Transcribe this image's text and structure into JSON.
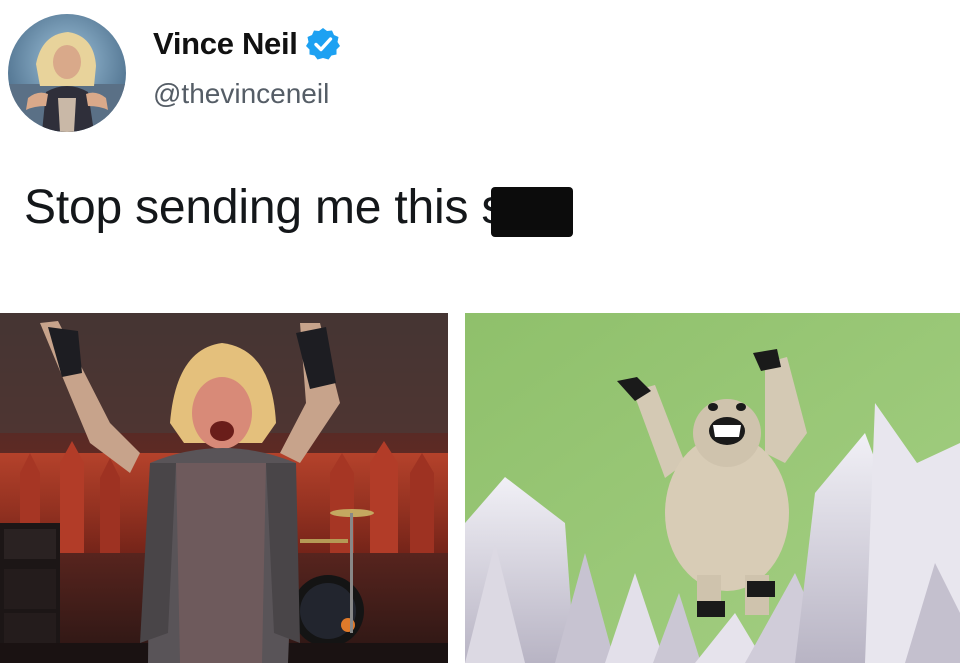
{
  "tweet": {
    "display_name": "Vince Neil",
    "handle": "@thevinceneil",
    "verified": true,
    "text": "Stop sending me this s",
    "censored": true
  },
  "icons": {
    "avatar": "avatar-photo",
    "verified": "verified-badge-icon"
  },
  "colors": {
    "verified_blue": "#1da1f2",
    "text": "#14171a",
    "handle": "#555d66"
  },
  "media": [
    {
      "name": "concert-photo",
      "description": "singer with arms raised on stage"
    },
    {
      "name": "abominable-snowman-photo",
      "description": "furry snow monster with arms raised on icy peaks"
    }
  ]
}
